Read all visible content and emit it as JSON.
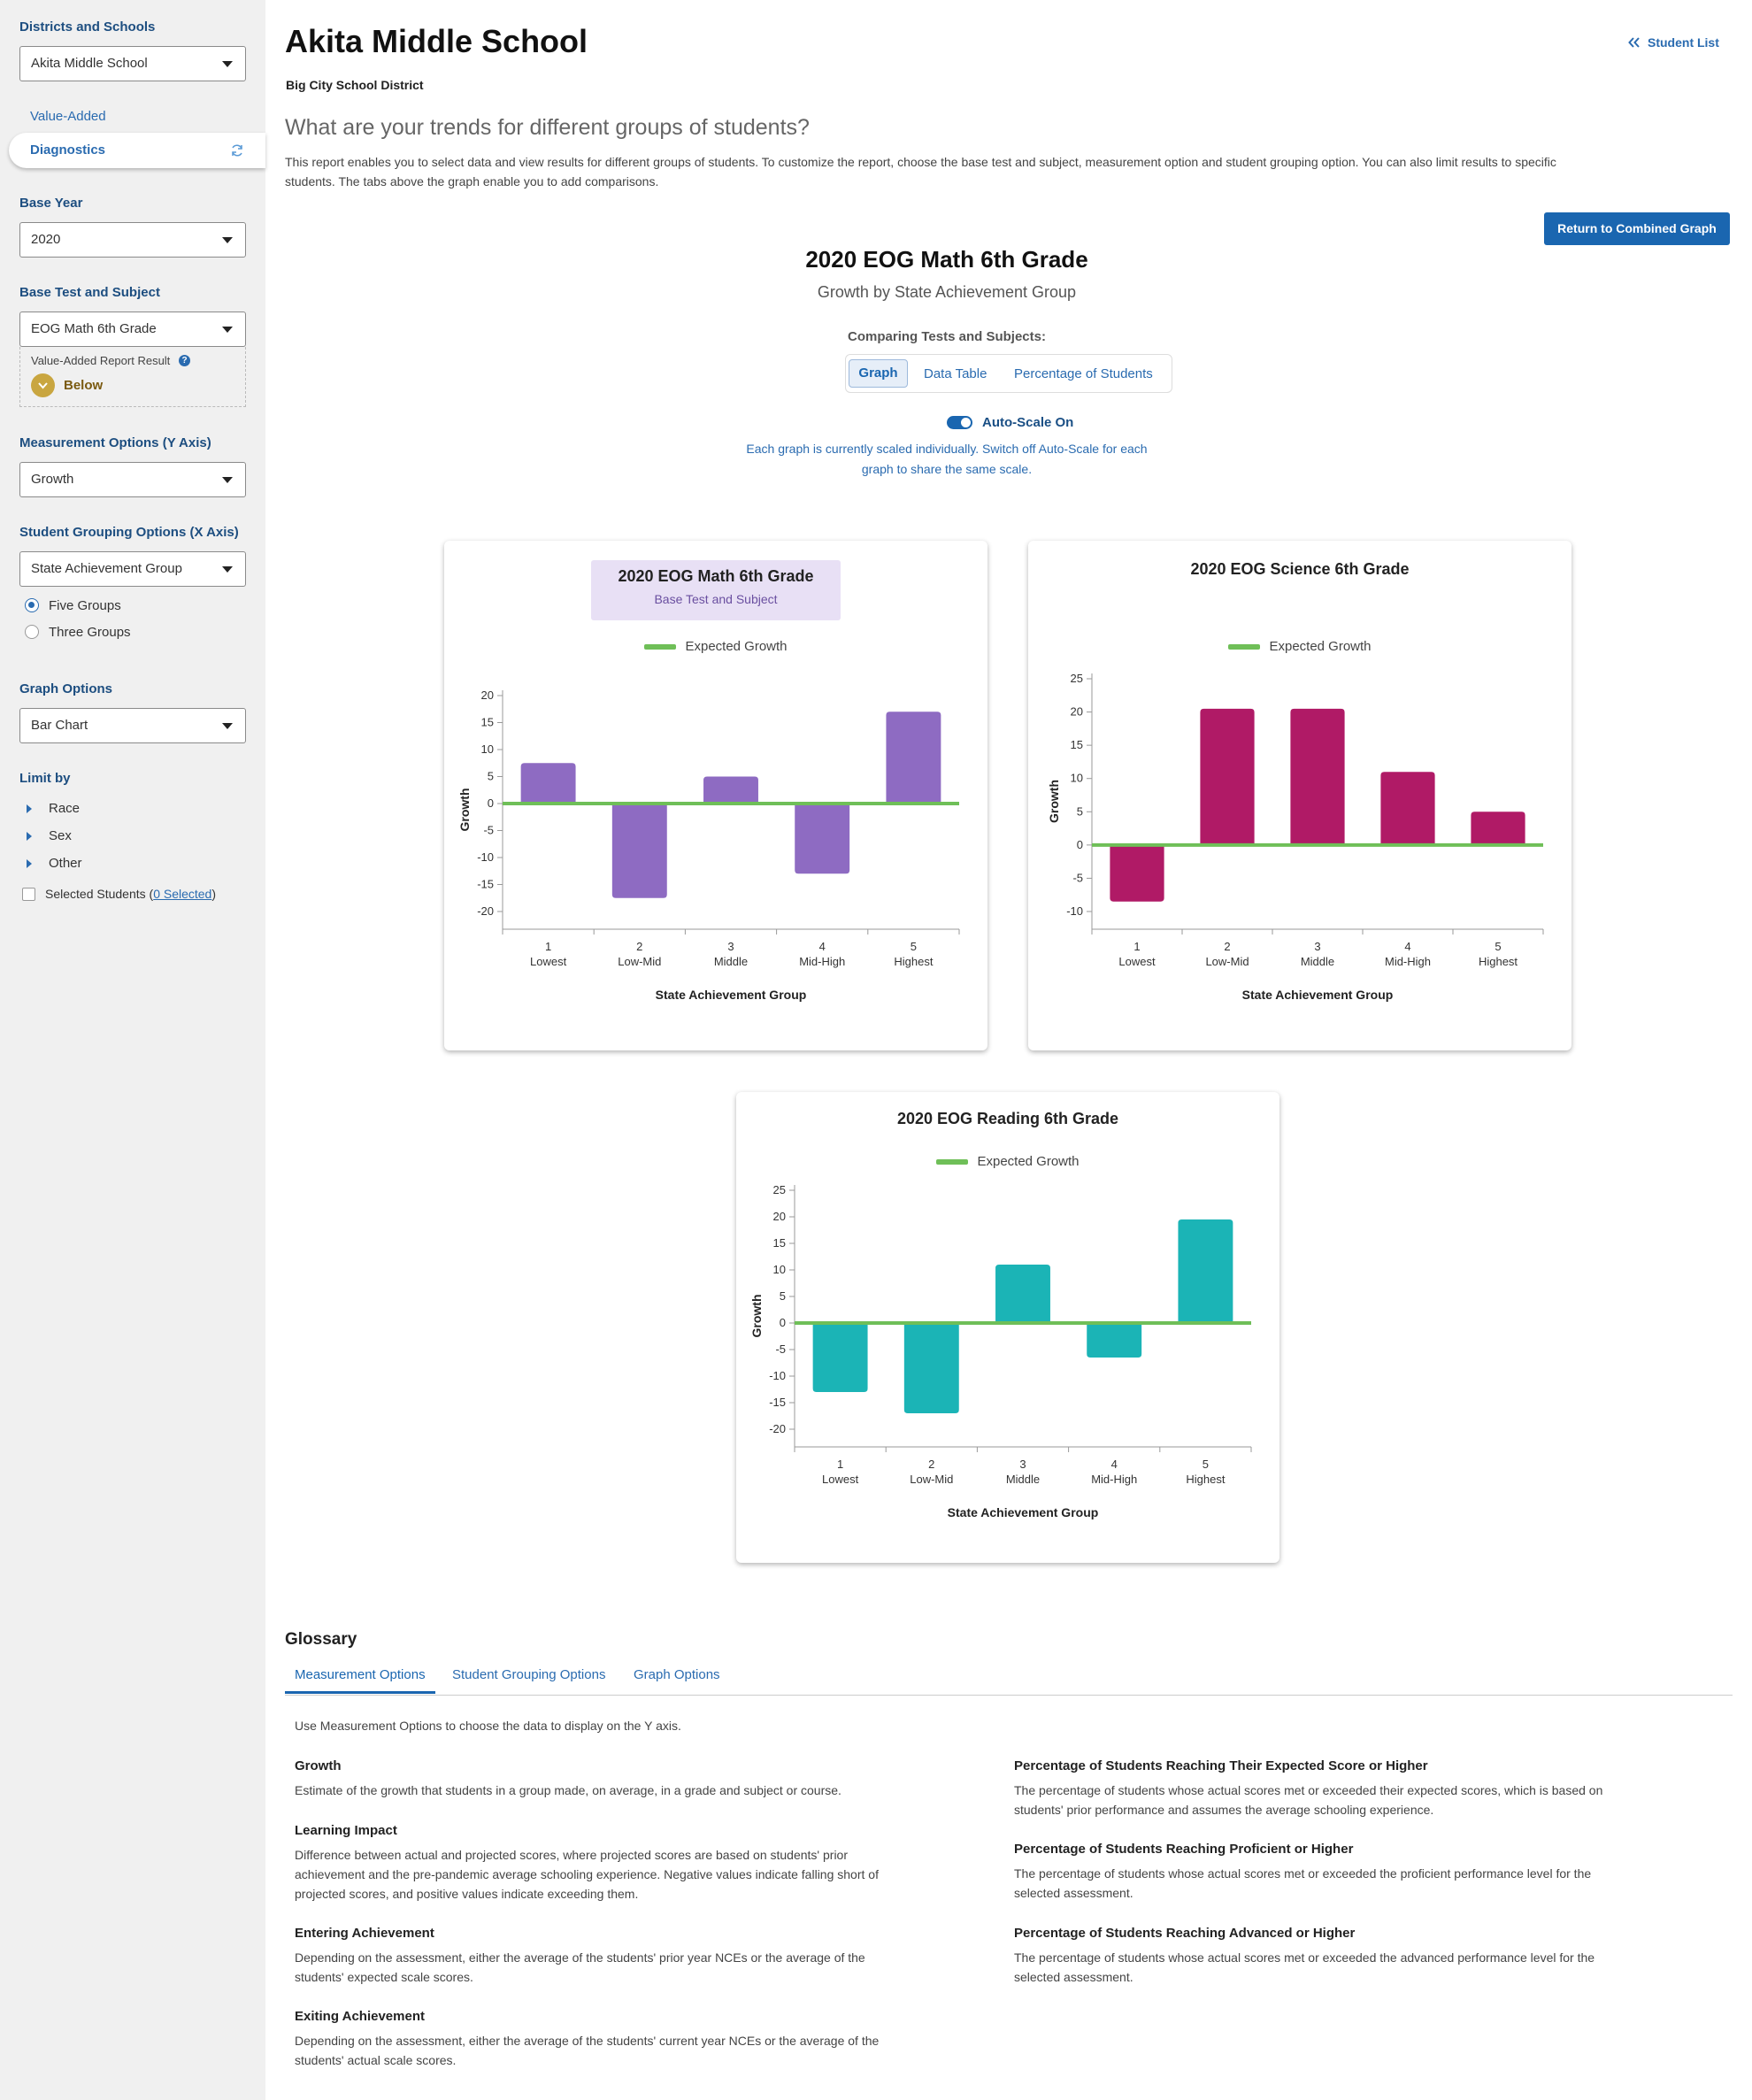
{
  "sidebar": {
    "districts_label": "Districts and Schools",
    "school_value": "Akita Middle School",
    "nav": {
      "value_added": "Value-Added",
      "diagnostics": "Diagnostics"
    },
    "base_year_label": "Base Year",
    "base_year_value": "2020",
    "base_test_label": "Base Test and Subject",
    "base_test_value": "EOG Math 6th Grade",
    "var_label": "Value-Added Report Result",
    "var_value": "Below",
    "measurement_label": "Measurement Options (Y Axis)",
    "measurement_value": "Growth",
    "grouping_label": "Student Grouping Options (X Axis)",
    "grouping_value": "State Achievement Group",
    "radio_five": "Five Groups",
    "radio_three": "Three Groups",
    "graph_options_label": "Graph Options",
    "graph_options_value": "Bar Chart",
    "limit_label": "Limit by",
    "limit_items": [
      "Race",
      "Sex",
      "Other"
    ],
    "selected_students": "Selected Students (",
    "selected_link": "0 Selected",
    "selected_close": ")"
  },
  "header": {
    "title": "Akita Middle School",
    "district": "Big City School District",
    "student_list": "Student List",
    "question": "What are your trends for different groups of students?",
    "description_1": "This report enables you to select data and view results for different groups of students. To customize the report, choose the base test and subject, measurement option and student grouping option. You can also limit results to specific",
    "description_2": "students. The tabs above the graph enable you to add comparisons.",
    "return_button": "Return to Combined Graph"
  },
  "report": {
    "title": "2020 EOG Math 6th Grade",
    "subtitle": "Growth by State Achievement Group",
    "comparing_label": "Comparing Tests and Subjects:",
    "tabs": [
      "Graph",
      "Data Table",
      "Percentage of Students"
    ],
    "autoscale_label": "Auto-Scale On",
    "autoscale_note_1": "Each graph is currently scaled individually. Switch off Auto-Scale for each",
    "autoscale_note_2": "graph to share the same scale.",
    "base_tag": "Base Test and Subject",
    "legend": "Expected Growth"
  },
  "colors": {
    "math": "#8e6bc2",
    "science": "#b01a66",
    "reading": "#1bb4b6",
    "expected": "#6fbf58",
    "accent": "#1a66b0"
  },
  "chart_data": [
    {
      "type": "bar",
      "title": "2020 EOG Math 6th Grade",
      "xlabel": "State Achievement Group",
      "ylabel": "Growth",
      "categories": [
        "1 Lowest",
        "2 Low-Mid",
        "3 Middle",
        "4 Mid-High",
        "5 Highest"
      ],
      "cat_num": [
        "1",
        "2",
        "3",
        "4",
        "5"
      ],
      "cat_name": [
        "Lowest",
        "Low-Mid",
        "Middle",
        "Mid-High",
        "Highest"
      ],
      "values": [
        7.5,
        -17.5,
        5,
        -13,
        17
      ],
      "ticks": [
        20,
        15,
        10,
        5,
        0,
        -5,
        -10,
        -15,
        -20
      ],
      "ylim": [
        -22,
        22
      ],
      "legend": "Expected Growth",
      "legend_position": "top"
    },
    {
      "type": "bar",
      "title": "2020 EOG Science 6th Grade",
      "xlabel": "State Achievement Group",
      "ylabel": "Growth",
      "categories": [
        "1 Lowest",
        "2 Low-Mid",
        "3 Middle",
        "4 Mid-High",
        "5 Highest"
      ],
      "cat_num": [
        "1",
        "2",
        "3",
        "4",
        "5"
      ],
      "cat_name": [
        "Lowest",
        "Low-Mid",
        "Middle",
        "Mid-High",
        "Highest"
      ],
      "values": [
        -8.5,
        20.5,
        20.5,
        11,
        5
      ],
      "ticks": [
        25,
        20,
        15,
        10,
        5,
        0,
        -5,
        -10
      ],
      "ylim": [
        -12,
        26
      ],
      "legend": "Expected Growth",
      "legend_position": "top"
    },
    {
      "type": "bar",
      "title": "2020 EOG Reading 6th Grade",
      "xlabel": "State Achievement Group",
      "ylabel": "Growth",
      "categories": [
        "1 Lowest",
        "2 Low-Mid",
        "3 Middle",
        "4 Mid-High",
        "5 Highest"
      ],
      "cat_num": [
        "1",
        "2",
        "3",
        "4",
        "5"
      ],
      "cat_name": [
        "Lowest",
        "Low-Mid",
        "Middle",
        "Mid-High",
        "Highest"
      ],
      "values": [
        -13,
        -17,
        11,
        -6.5,
        19.5
      ],
      "ticks": [
        25,
        20,
        15,
        10,
        5,
        0,
        -5,
        -10,
        -15,
        -20
      ],
      "ylim": [
        -22,
        26
      ],
      "legend": "Expected Growth",
      "legend_position": "top"
    }
  ],
  "glossary": {
    "title": "Glossary",
    "tabs": [
      "Measurement Options",
      "Student Grouping Options",
      "Graph Options"
    ],
    "intro": "Use Measurement Options to choose the data to display on the Y axis.",
    "left": [
      {
        "term": "Growth",
        "lines": [
          "Estimate of the growth that students in a group made, on average, in a grade and subject or course."
        ]
      },
      {
        "term": "Learning Impact",
        "lines": [
          "Difference between actual and projected scores, where projected scores are based on students' prior",
          "achievement and the pre-pandemic average schooling experience. Negative values indicate falling short of",
          "projected scores, and positive values indicate exceeding them."
        ]
      },
      {
        "term": "Entering Achievement",
        "lines": [
          "Depending on the assessment, either the average of the students' prior year NCEs or the average of the",
          "students' expected scale scores."
        ]
      },
      {
        "term": "Exiting Achievement",
        "lines": [
          "Depending on the assessment, either the average of the students' current year NCEs or the average of the",
          "students' actual scale scores."
        ]
      }
    ],
    "right": [
      {
        "term": "Percentage of Students Reaching Their Expected Score or Higher",
        "lines": [
          "The percentage of students whose actual scores met or exceeded their expected scores, which is based on",
          "students' prior performance and assumes the average schooling experience."
        ]
      },
      {
        "term": "Percentage of Students Reaching Proficient or Higher",
        "lines": [
          "The percentage of students whose actual scores met or exceeded the proficient performance level for the",
          "selected assessment."
        ]
      },
      {
        "term": "Percentage of Students Reaching Advanced or Higher",
        "lines": [
          "The percentage of students whose actual scores met or exceeded the advanced performance level for the",
          "selected assessment."
        ]
      }
    ]
  }
}
